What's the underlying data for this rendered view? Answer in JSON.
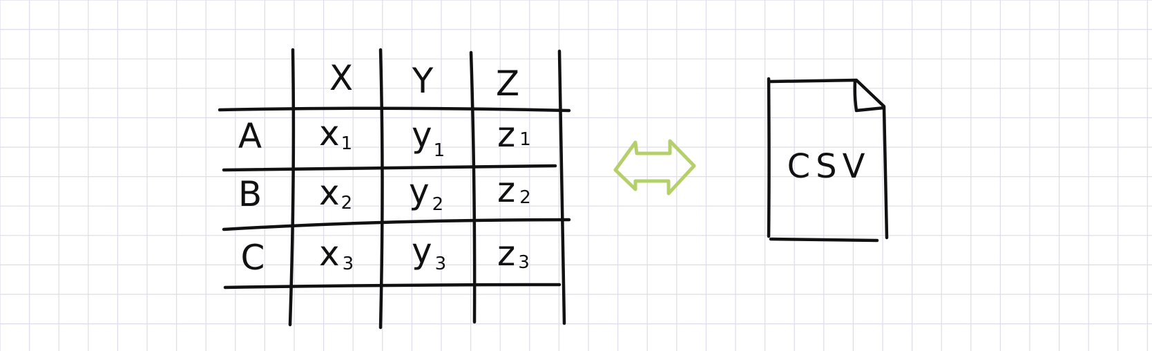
{
  "diagram": {
    "table": {
      "column_headers": [
        "X",
        "Y",
        "Z"
      ],
      "rows": [
        {
          "label": "A",
          "cells": [
            {
              "letter": "x",
              "sub": "1"
            },
            {
              "letter": "y",
              "sub": "1"
            },
            {
              "letter": "z",
              "sub": "1"
            }
          ]
        },
        {
          "label": "B",
          "cells": [
            {
              "letter": "x",
              "sub": "2"
            },
            {
              "letter": "y",
              "sub": "2"
            },
            {
              "letter": "z",
              "sub": "2"
            }
          ]
        },
        {
          "label": "C",
          "cells": [
            {
              "letter": "x",
              "sub": "3"
            },
            {
              "letter": "y",
              "sub": "3"
            },
            {
              "letter": "z",
              "sub": "3"
            }
          ]
        }
      ]
    },
    "arrow": {
      "icon": "double-arrow-icon",
      "color": "#b5d06a"
    },
    "file": {
      "icon": "file-icon",
      "label": "CSV"
    },
    "colors": {
      "ink": "#111111",
      "grid": "#dcdcea",
      "background": "#ffffff"
    }
  }
}
